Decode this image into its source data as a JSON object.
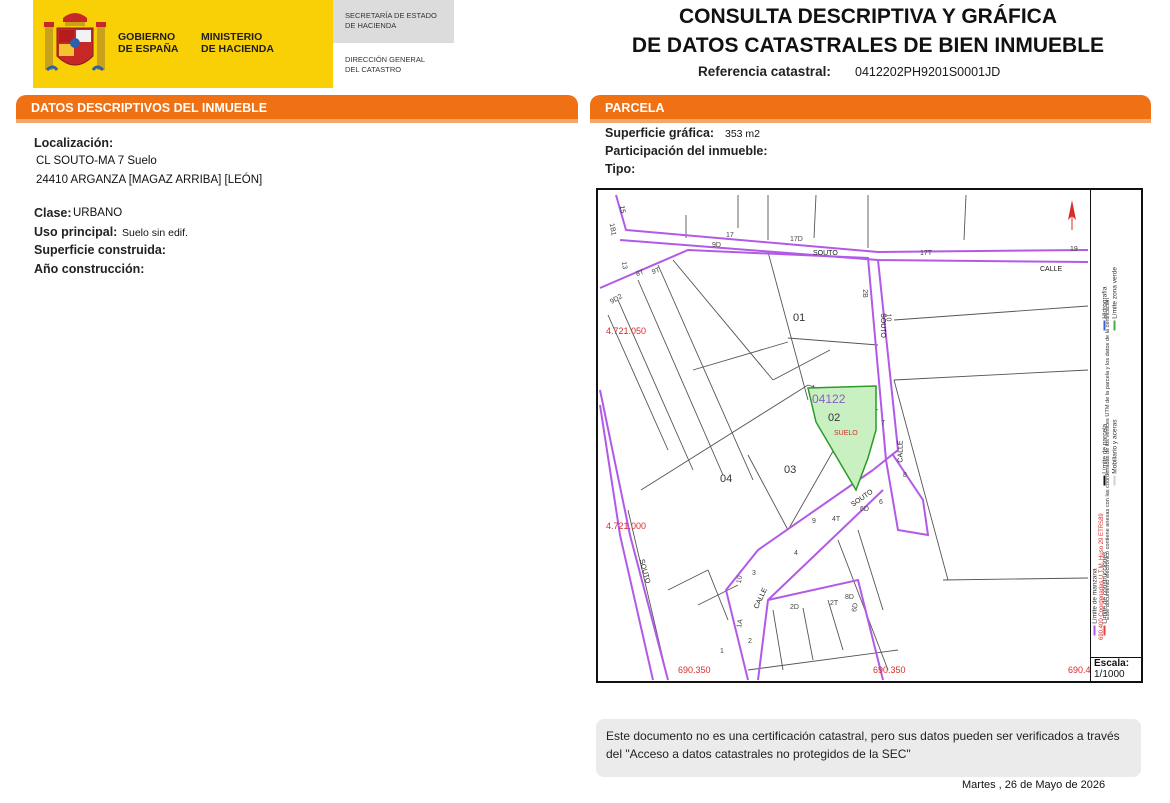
{
  "header": {
    "gobierno": [
      "GOBIERNO",
      "DE ESPAÑA"
    ],
    "ministerio": [
      "MINISTERIO",
      "DE HACIENDA"
    ],
    "secretaria": [
      "SECRETARÍA DE ESTADO",
      "DE HACIENDA"
    ],
    "direccion": [
      "DIRECCIÓN GENERAL",
      "DEL CATASTRO"
    ]
  },
  "title": {
    "line1": "CONSULTA DESCRIPTIVA Y GRÁFICA",
    "line2": "DE DATOS CATASTRALES DE BIEN INMUEBLE",
    "ref_label": "Referencia catastral:",
    "ref_value": "0412202PH9201S0001JD"
  },
  "descriptivos": {
    "heading": "DATOS DESCRIPTIVOS DEL INMUEBLE",
    "localizacion_label": "Localización:",
    "localizacion_line1": "CL SOUTO-MA 7 Suelo",
    "localizacion_line2": "24410 ARGANZA [MAGAZ ARRIBA] [LEÓN]",
    "clase_label": "Clase:",
    "clase_value": "URBANO",
    "uso_label": "Uso principal:",
    "uso_value": "Suelo sin edif.",
    "superficie_label": "Superficie construida:",
    "anio_label": "Año construcción:"
  },
  "parcela": {
    "heading": "PARCELA",
    "superficie_label": "Superficie gráfica:",
    "superficie_value": "353 m2",
    "participacion_label": "Participación del inmueble:",
    "tipo_label": "Tipo:"
  },
  "map": {
    "parcel_ref": "04122",
    "parcel_num": "02",
    "parcel_tag": "SUELO",
    "lot_labels": [
      "01",
      "03",
      "04"
    ],
    "street_labels": [
      "SOUTO",
      "CALLE",
      "SOUTO",
      "CALLE",
      "SOUTO",
      "CALLE",
      "SOUTO"
    ],
    "number_labels": [
      "15",
      "9D",
      "17",
      "17D",
      "17T",
      "19",
      "1B1",
      "13",
      "8T",
      "9T",
      "9D2",
      "2B",
      "10",
      "7",
      "8",
      "6",
      "6D",
      "4T",
      "9",
      "4",
      "3",
      "10",
      "2D",
      "2T",
      "1A",
      "2",
      "1",
      "8D",
      "6D"
    ],
    "coord_labels": [
      "4.721.050",
      "4.721.000",
      "690.350",
      "690.350",
      "690.4"
    ],
    "colors": {
      "parcel_fill": "#c9f0c0",
      "parcel_stroke": "#2b9a2b",
      "block_line": "#a449e6",
      "construction_line": "#e34141",
      "coord_text": "#d92c2c",
      "parcel_ref_text": "#8a5dc9"
    }
  },
  "legend": {
    "manzana": "Límite de manzana",
    "construcciones": "Límite de construcciones",
    "parcela": "Límite de parcela",
    "mobiliario": "Mobiliario y aceras",
    "hidrografia": "Hidrografía",
    "zona_verde": "Límite zona verde",
    "coord_note_red": "690.400 Coordenadas U.T.M. Huso 29 ETRS89",
    "coord_note_black": "Este documento electrónico contiene anexas con las coordenadas de los vértices UTM de la parcela y los datos de la certificación",
    "escala_label": "Escala:",
    "escala_value": "1/1000"
  },
  "notice": {
    "text": "Este documento no es una certificación catastral, pero sus datos pueden ser verificados a través del \"Acceso a datos catastrales no protegidos de la SEC\""
  },
  "footer": {
    "date": "Martes , 26 de Mayo de 2026"
  }
}
